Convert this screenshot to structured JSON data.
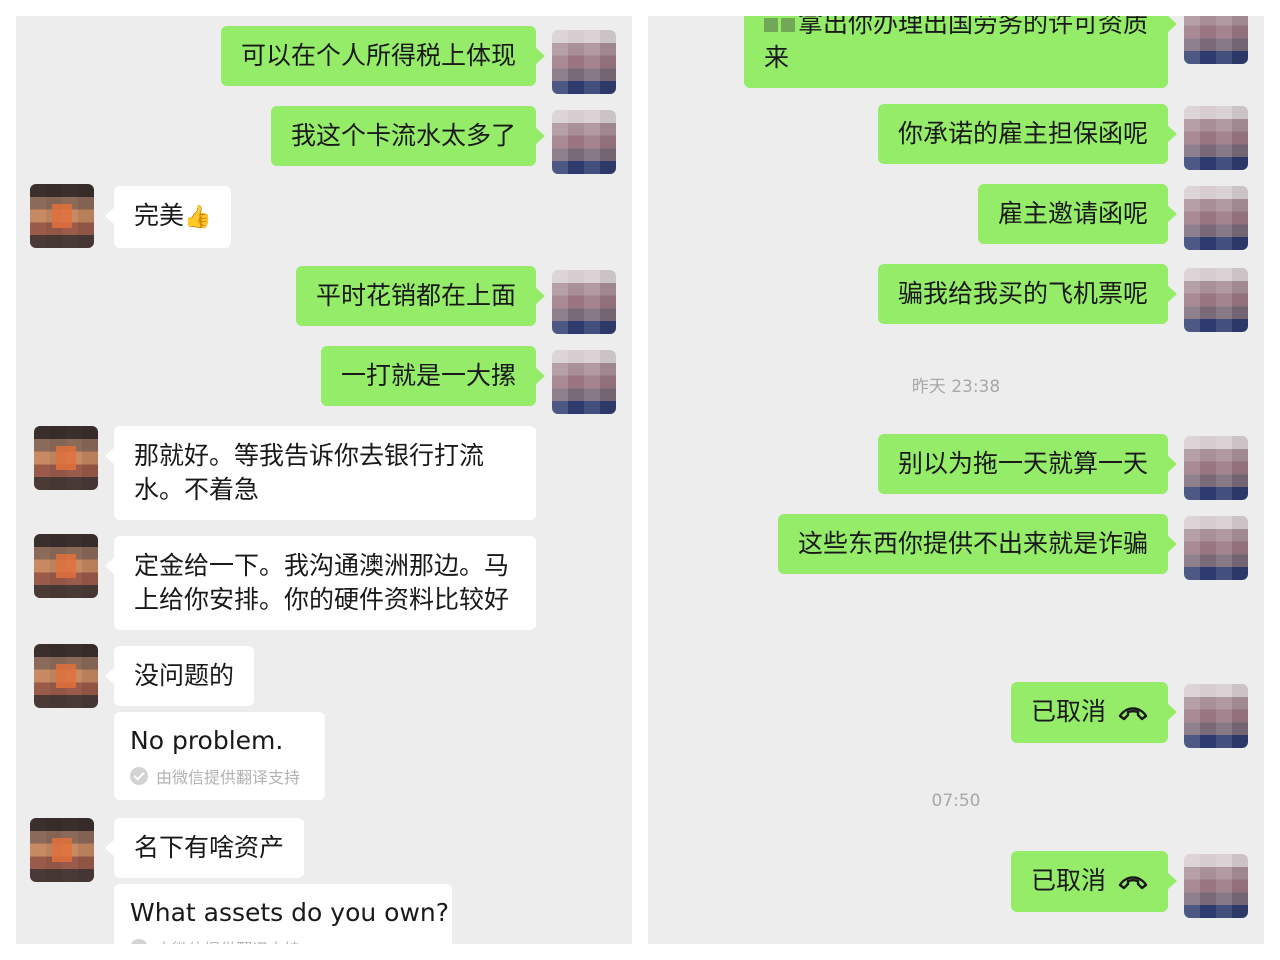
{
  "left": {
    "messages": [
      {
        "text": "可以在个人所得税上体现"
      },
      {
        "text": "我这个卡流水太多了"
      },
      {
        "text": "完美",
        "emoji": "👍"
      },
      {
        "text": "平时花销都在上面"
      },
      {
        "text": "一打就是一大摞"
      },
      {
        "text": "那就好。等我告诉你去银行打流水。不着急"
      },
      {
        "text": "定金给一下。我沟通澳洲那边。马上给你安排。你的硬件资料比较好"
      },
      {
        "text": "没问题的",
        "translation": "No problem.",
        "translation_note": "由微信提供翻译支持"
      },
      {
        "text": "名下有啥资产",
        "translation": "What assets do you own?",
        "translation_note": "由微信提供翻译支持"
      }
    ]
  },
  "right": {
    "messages": [
      {
        "text": "拿出你办理出国劳务的许可资质来"
      },
      {
        "text": "你承诺的雇主担保函呢"
      },
      {
        "text": "雇主邀请函呢"
      },
      {
        "text": "骗我给我买的飞机票呢"
      },
      {
        "timestamp": "昨天 23:38"
      },
      {
        "text": "别以为拖一天就算一天"
      },
      {
        "text": "这些东西你提供不出来就是诈骗"
      },
      {
        "text": "已取消",
        "icon": "phone-hangup-icon"
      },
      {
        "timestamp": "07:50"
      },
      {
        "text": "已取消",
        "icon": "phone-hangup-icon"
      }
    ]
  },
  "colors": {
    "sent_bubble": "#95ec69",
    "received_bubble": "#ffffff",
    "chat_background": "#ededed",
    "timestamp": "#a8a8a8"
  }
}
